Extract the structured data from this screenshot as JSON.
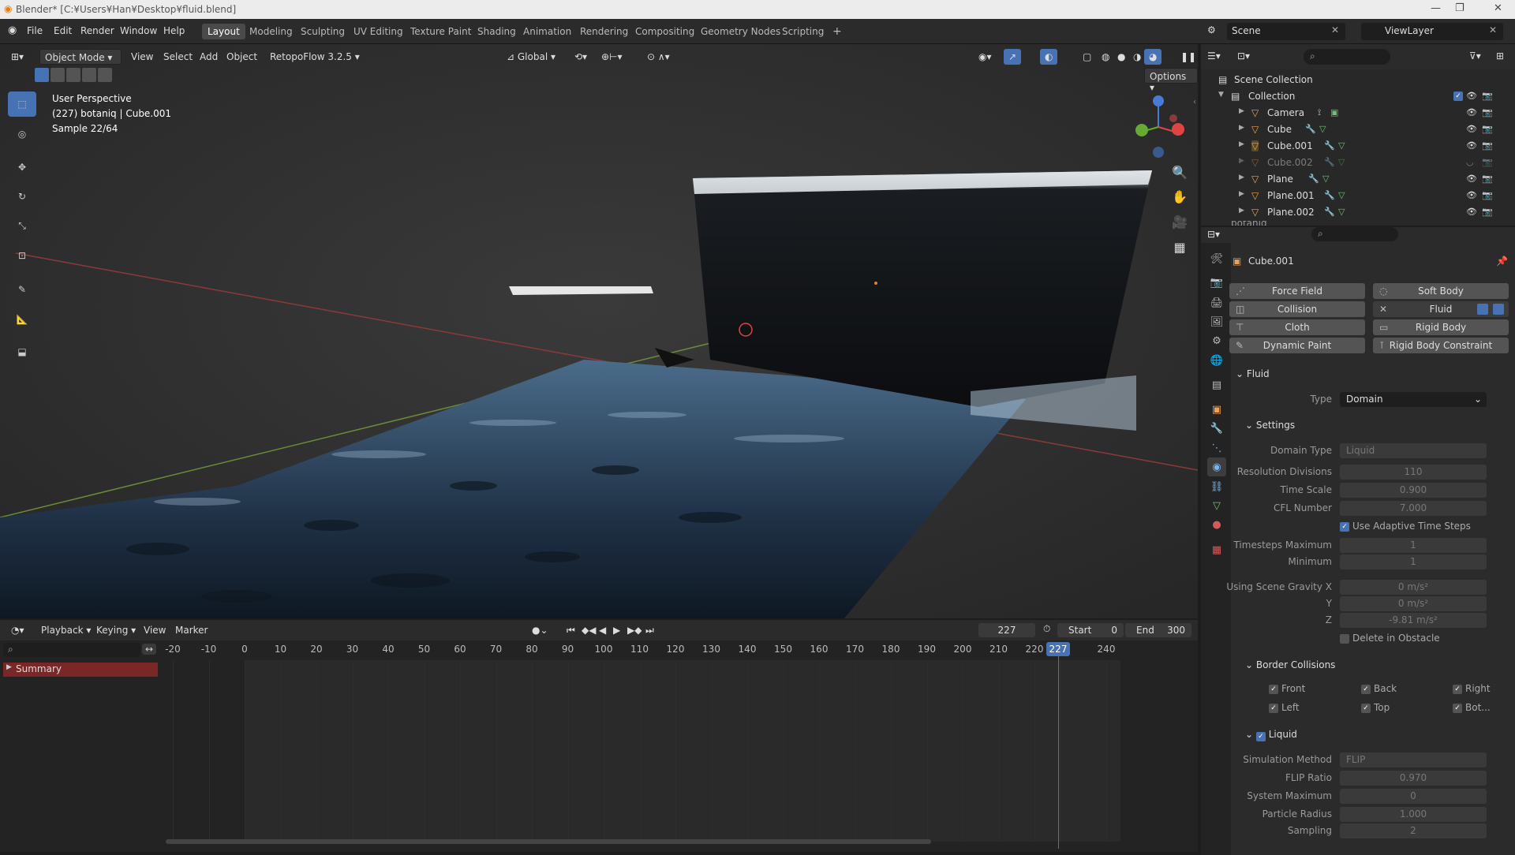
{
  "titlebar": {
    "title": "Blender* [C:¥Users¥Han¥Desktop¥fluid.blend]"
  },
  "menu": {
    "items": [
      "File",
      "Edit",
      "Render",
      "Window",
      "Help"
    ]
  },
  "workspaces": {
    "tabs": [
      "Layout",
      "Modeling",
      "Sculpting",
      "UV Editing",
      "Texture Paint",
      "Shading",
      "Animation",
      "Rendering",
      "Compositing",
      "Geometry Nodes",
      "Scripting"
    ],
    "active": "Layout"
  },
  "top_right": {
    "scene": "Scene",
    "view_layer": "ViewLayer"
  },
  "viewport_header": {
    "mode": "Object Mode",
    "menus": [
      "View",
      "Select",
      "Add",
      "Object"
    ],
    "addon": "RetopoFlow 3.2.5",
    "orientation": "Global",
    "options": "Options"
  },
  "viewport_info": {
    "line1": "User Perspective",
    "line2": "(227) botaniq | Cube.001",
    "line3": "Sample 22/64"
  },
  "outliner": {
    "root": "Scene Collection",
    "collection": "Collection",
    "items": [
      "Camera",
      "Cube",
      "Cube.001",
      "Cube.002",
      "Plane",
      "Plane.001",
      "Plane.002"
    ],
    "partial": "botaniq"
  },
  "properties": {
    "object_name": "Cube.001",
    "physics_buttons": {
      "force_field": "Force Field",
      "soft_body": "Soft Body",
      "collision": "Collision",
      "fluid": "Fluid",
      "cloth": "Cloth",
      "rigid_body": "Rigid Body",
      "dynamic_paint": "Dynamic Paint",
      "rigid_body_constraint": "Rigid Body Constraint"
    },
    "fluid_panel": "Fluid",
    "type_label": "Type",
    "type_value": "Domain",
    "settings_header": "Settings",
    "settings": [
      {
        "label": "Domain Type",
        "value": "Liquid"
      },
      {
        "label": "Resolution Divisions",
        "value": "110"
      },
      {
        "label": "Time Scale",
        "value": "0.900"
      },
      {
        "label": "CFL Number",
        "value": "7.000"
      },
      {
        "label": "Timesteps Maximum",
        "value": "1"
      },
      {
        "label": "Minimum",
        "value": "1"
      },
      {
        "label": "Using Scene Gravity X",
        "value": "0 m/s²"
      },
      {
        "label": "Y",
        "value": "0 m/s²"
      },
      {
        "label": "Z",
        "value": "-9.81 m/s²"
      }
    ],
    "adaptive_time_steps": "Use Adaptive Time Steps",
    "delete_in_obstacle": "Delete in Obstacle",
    "border_header": "Border Collisions",
    "borders": [
      "Front",
      "Back",
      "Right",
      "Left",
      "Top",
      "Bot..."
    ],
    "liquid_header": "Liquid",
    "liquid": [
      {
        "label": "Simulation Method",
        "value": "FLIP"
      },
      {
        "label": "FLIP Ratio",
        "value": "0.970"
      },
      {
        "label": "System Maximum",
        "value": "0"
      },
      {
        "label": "Particle Radius",
        "value": "1.000"
      },
      {
        "label": "Sampling",
        "value": "2"
      }
    ]
  },
  "timeline": {
    "menus": [
      "Playback",
      "Keying",
      "View",
      "Marker"
    ],
    "current_frame": "227",
    "start_label": "Start",
    "start": "0",
    "end_label": "End",
    "end": "300",
    "summary": "Summary",
    "ticks": [
      "-20",
      "-10",
      "0",
      "10",
      "20",
      "30",
      "40",
      "50",
      "60",
      "70",
      "80",
      "90",
      "100",
      "110",
      "120",
      "130",
      "140",
      "150",
      "160",
      "170",
      "180",
      "190",
      "200",
      "210",
      "220",
      "227",
      "240"
    ]
  },
  "colors": {
    "accent": "#4772b3",
    "active_frame": "#4772b3",
    "summary_bg": "#7a2727"
  }
}
